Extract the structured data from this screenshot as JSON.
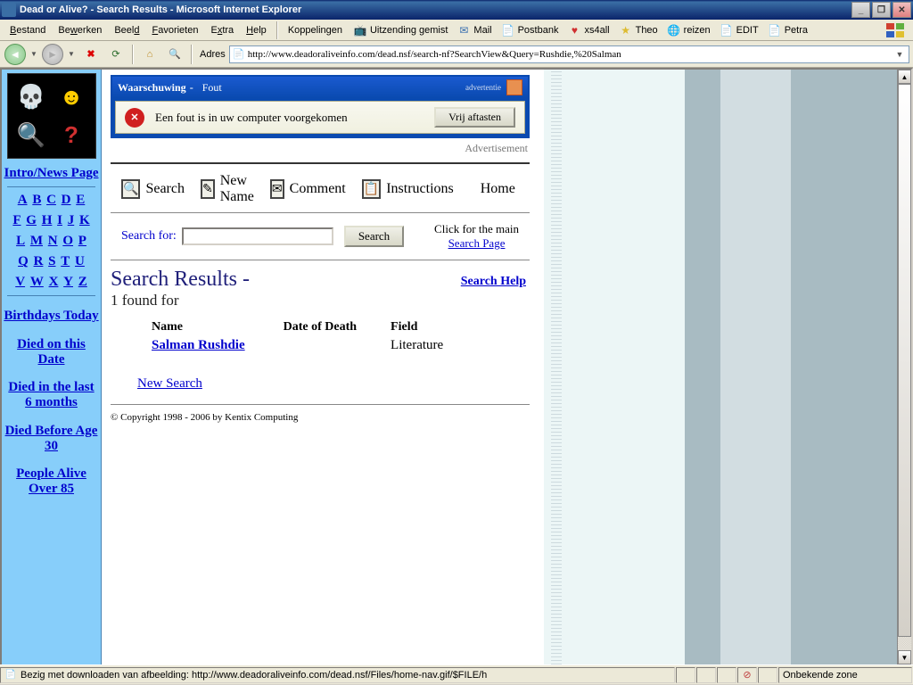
{
  "window": {
    "title": "Dead or Alive? - Search Results - Microsoft Internet Explorer"
  },
  "menu": {
    "items": [
      "Bestand",
      "Bewerken",
      "Beeld",
      "Favorieten",
      "Extra",
      "Help"
    ],
    "koppelingen": "Koppelingen",
    "links": [
      {
        "icon": "📺",
        "label": "Uitzending gemist"
      },
      {
        "icon": "✉",
        "label": "Mail"
      },
      {
        "icon": "📄",
        "label": "Postbank"
      },
      {
        "icon": "♥",
        "label": "xs4all",
        "color": "#d03030"
      },
      {
        "icon": "★",
        "label": "Theo",
        "color": "#ddbb30"
      },
      {
        "icon": "🌐",
        "label": "reizen"
      },
      {
        "icon": "📄",
        "label": "EDIT"
      },
      {
        "icon": "📄",
        "label": "Petra"
      }
    ]
  },
  "nav": {
    "adres": "Adres",
    "url": "http://www.deadoraliveinfo.com/dead.nsf/search-nf?SearchView&Query=Rushdie,%20Salman"
  },
  "sidebar": {
    "intro": "Intro/News Page",
    "alpha": [
      [
        "A",
        "B",
        "C",
        "D",
        "E"
      ],
      [
        "F",
        "G",
        "H",
        "I",
        "J",
        "K"
      ],
      [
        "L",
        "M",
        "N",
        "O",
        "P"
      ],
      [
        "Q",
        "R",
        "S",
        "T",
        "U"
      ],
      [
        "V",
        "W",
        "X",
        "Y",
        "Z"
      ]
    ],
    "links": [
      "Birthdays Today",
      "Died on this Date",
      "Died in the last 6 months",
      "Died Before Age 30",
      "People Alive Over 85"
    ]
  },
  "ad": {
    "title1": "Waarschuwing",
    "title2": "Fout",
    "label": "advertentie",
    "text": "Een fout is in uw computer voorgekomen",
    "button": "Vrij aftasten",
    "note": "Advertisement"
  },
  "sitenav": {
    "search": "Search",
    "newname": "New Name",
    "comment": "Comment",
    "instructions": "Instructions",
    "home": "Home"
  },
  "searchrow": {
    "label": "Search for:",
    "button": "Search",
    "hint1": "Click for the main",
    "hint2": "Search Page"
  },
  "results": {
    "title": "Search Results -",
    "count": "1 found for",
    "help": "Search Help",
    "cols": {
      "name": "Name",
      "dod": "Date of Death",
      "field": "Field"
    },
    "rows": [
      {
        "name": "Salman Rushdie",
        "dod": "",
        "field": "Literature"
      }
    ],
    "newsearch": "New Search"
  },
  "copyright": "© Copyright 1998 - 2006 by Kentix Computing",
  "status": {
    "text": "Bezig met downloaden van afbeelding: http://www.deadoraliveinfo.com/dead.nsf/Files/home-nav.gif/$FILE/h",
    "zone": "Onbekende zone"
  }
}
